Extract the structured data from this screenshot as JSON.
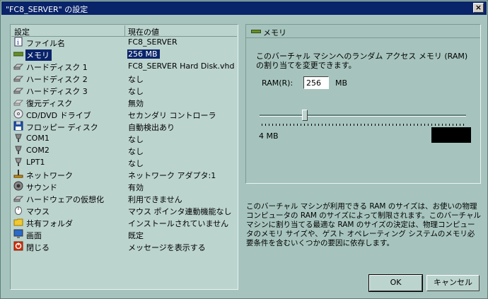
{
  "window": {
    "title": "\"FC8_SERVER\" の設定",
    "close_label": "×"
  },
  "list": {
    "header_setting": "設定",
    "header_value": "現在の値",
    "items": [
      {
        "label": "ファイル名",
        "value": "FC8_SERVER",
        "icon": "info-icon"
      },
      {
        "label": "メモリ",
        "value": "256 MB",
        "icon": "memory-icon",
        "selected": true
      },
      {
        "label": "ハードディスク 1",
        "value": "FC8_SERVER Hard Disk.vhd",
        "icon": "harddisk-icon"
      },
      {
        "label": "ハードディスク 2",
        "value": "なし",
        "icon": "harddisk-icon"
      },
      {
        "label": "ハードディスク 3",
        "value": "なし",
        "icon": "harddisk-icon"
      },
      {
        "label": "復元ディスク",
        "value": "無効",
        "icon": "undo-disk-icon"
      },
      {
        "label": "CD/DVD ドライブ",
        "value": "セカンダリ コントローラ",
        "icon": "cd-icon"
      },
      {
        "label": "フロッピー ディスク",
        "value": "自動検出あり",
        "icon": "floppy-icon"
      },
      {
        "label": "COM1",
        "value": "なし",
        "icon": "com-port-icon"
      },
      {
        "label": "COM2",
        "value": "なし",
        "icon": "com-port-icon"
      },
      {
        "label": "LPT1",
        "value": "なし",
        "icon": "lpt-port-icon"
      },
      {
        "label": "ネットワーク",
        "value": "ネットワーク アダプタ:1",
        "icon": "network-icon"
      },
      {
        "label": "サウンド",
        "value": "有効",
        "icon": "sound-icon"
      },
      {
        "label": "ハードウェアの仮想化",
        "value": "利用できません",
        "icon": "hardware-virtualization-icon"
      },
      {
        "label": "マウス",
        "value": "マウス ポインタ連動機能なし",
        "icon": "mouse-icon"
      },
      {
        "label": "共有フォルダ",
        "value": "インストールされていません",
        "icon": "folder-icon"
      },
      {
        "label": "画面",
        "value": "既定",
        "icon": "display-icon"
      },
      {
        "label": "閉じる",
        "value": "メッセージを表示する",
        "icon": "close-action-icon"
      }
    ]
  },
  "memory_panel": {
    "title": "メモリ",
    "description": "このバーチャル マシンへのランダム アクセス メモリ (RAM) の割り当てを変更できます。",
    "ram_label": "RAM(R):",
    "ram_value": "256",
    "ram_unit": "MB",
    "slider_min_label": "4 MB",
    "slider_fraction": 0.22
  },
  "info_text": "このバーチャル マシンが利用できる RAM のサイズは、お使いの物理コンピュータの RAM のサイズによって制限されます。このバーチャル マシンに割り当てる最適な RAM のサイズの決定は、物理コンピュータのメモリ サイズや、ゲスト オペレーティング システムのメモリ必要条件を含むいくつかの要因に依存します。",
  "buttons": {
    "ok": "OK",
    "cancel": "キャンセル"
  }
}
